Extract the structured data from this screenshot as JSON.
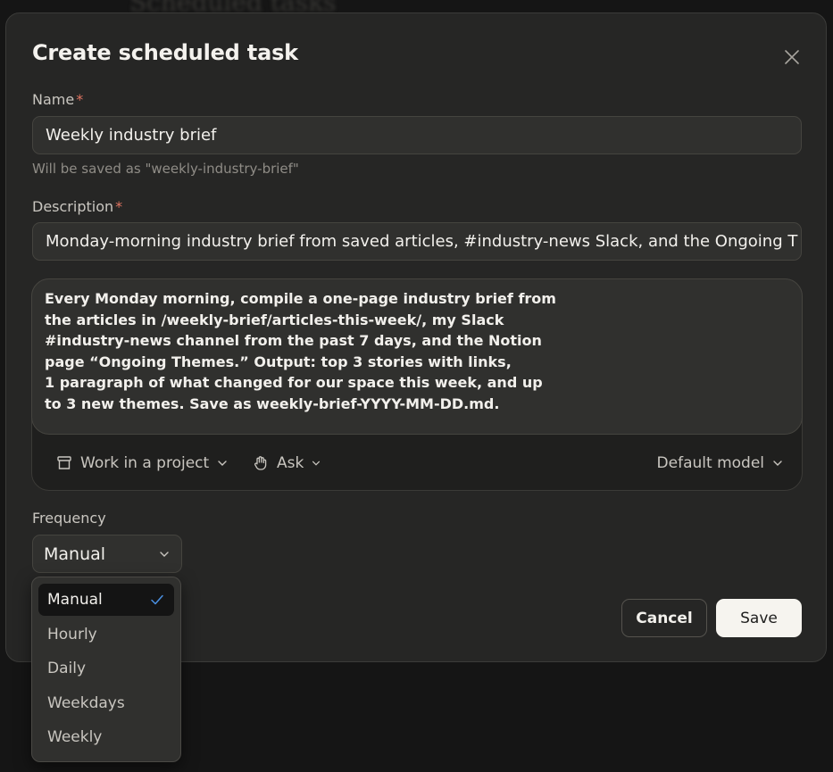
{
  "background": {
    "page_title": "Scheduled tasks"
  },
  "modal": {
    "title": "Create scheduled task",
    "close_icon": "close-icon"
  },
  "name_field": {
    "label": "Name",
    "required_marker": "*",
    "value": "Weekly industry brief",
    "hint": "Will be saved as \"weekly-industry-brief\""
  },
  "description_field": {
    "label": "Description",
    "required_marker": "*",
    "value": "Monday-morning industry brief from saved articles, #industry-news Slack, and the Ongoing T"
  },
  "prompt": {
    "lines": [
      "Every Monday morning, compile a one-page industry brief from",
      "the articles in /weekly-brief/articles-this-week/, my Slack",
      "#industry-news channel from the past 7 days, and the Notion",
      "page “Ongoing Themes.” Output: top 3 stories with links,",
      "1 paragraph of what changed for our space this week, and up",
      "to 3 new themes. Save as weekly-brief-YYYY-MM-DD.md."
    ],
    "toolbar": {
      "project_label": "Work in a project",
      "project_icon": "project-box-icon",
      "mode_label": "Ask",
      "mode_icon": "hand-icon",
      "model_label": "Default model"
    }
  },
  "frequency": {
    "label": "Frequency",
    "selected": "Manual",
    "options": [
      {
        "label": "Manual",
        "selected": true
      },
      {
        "label": "Hourly",
        "selected": false
      },
      {
        "label": "Daily",
        "selected": false
      },
      {
        "label": "Weekdays",
        "selected": false
      },
      {
        "label": "Weekly",
        "selected": false
      }
    ]
  },
  "buttons": {
    "cancel": "Cancel",
    "save": "Save"
  },
  "colors": {
    "modal_bg": "#262625",
    "input_bg": "#30302e",
    "required": "#e07461",
    "check": "#4a90e2",
    "save_bg": "#f6f4ef"
  }
}
